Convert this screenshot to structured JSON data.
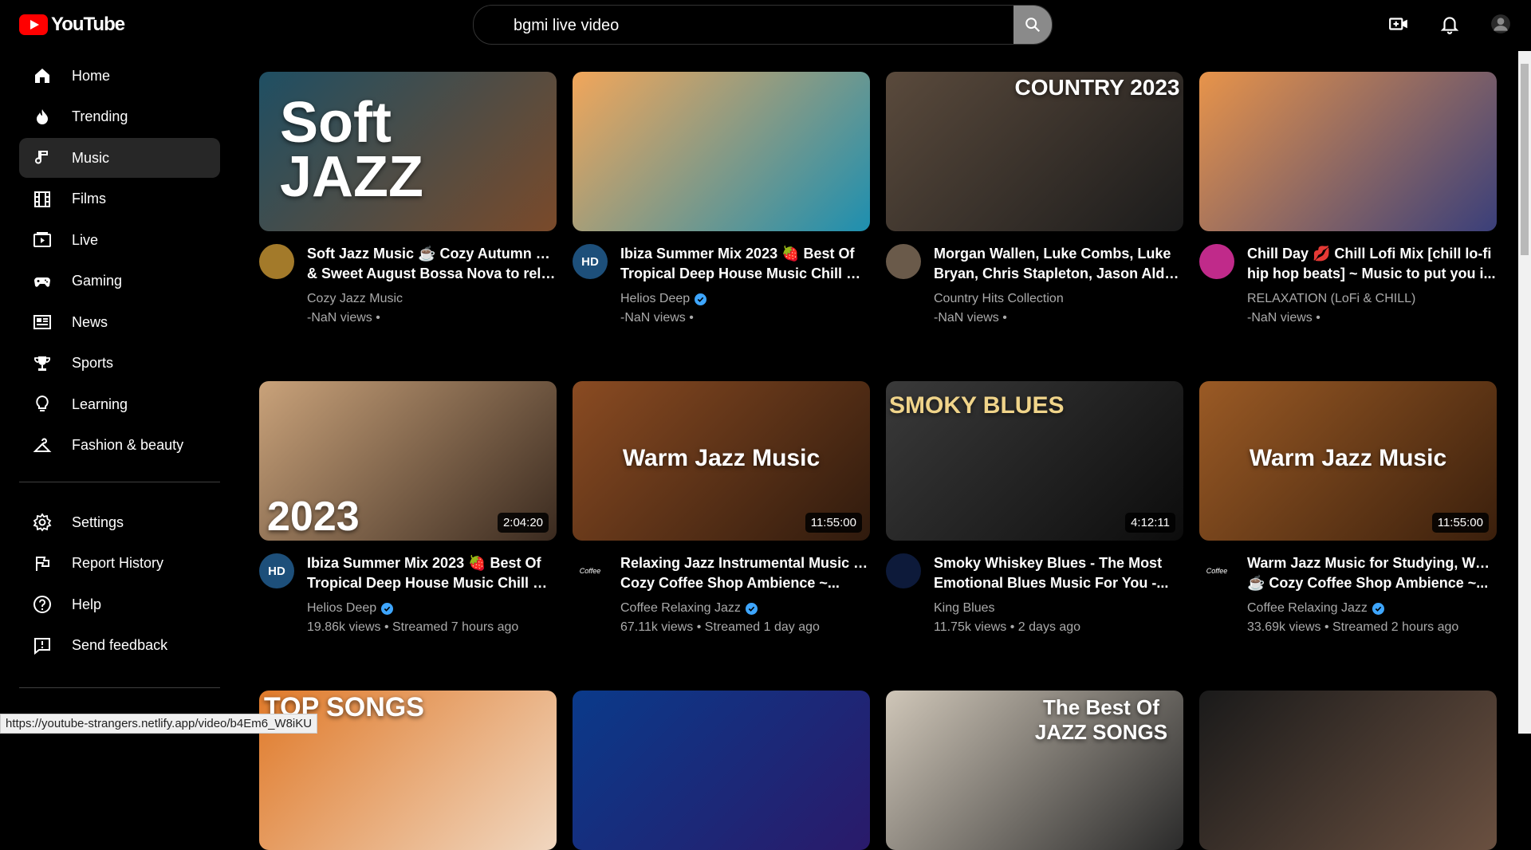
{
  "brand": {
    "name": "YouTube"
  },
  "search": {
    "value": "bgmi live video"
  },
  "sidebar": {
    "items": [
      {
        "label": "Home",
        "icon": "home-icon"
      },
      {
        "label": "Trending",
        "icon": "flame-icon"
      },
      {
        "label": "Music",
        "icon": "music-note-icon",
        "active": true
      },
      {
        "label": "Films",
        "icon": "film-icon"
      },
      {
        "label": "Live",
        "icon": "live-icon"
      },
      {
        "label": "Gaming",
        "icon": "gamepad-icon"
      },
      {
        "label": "News",
        "icon": "news-icon"
      },
      {
        "label": "Sports",
        "icon": "trophy-icon"
      },
      {
        "label": "Learning",
        "icon": "lightbulb-icon"
      },
      {
        "label": "Fashion & beauty",
        "icon": "hanger-icon"
      }
    ],
    "footer_items": [
      {
        "label": "Settings",
        "icon": "gear-icon"
      },
      {
        "label": "Report History",
        "icon": "flag-icon"
      },
      {
        "label": "Help",
        "icon": "help-icon"
      },
      {
        "label": "Send feedback",
        "icon": "feedback-icon"
      }
    ]
  },
  "videos": [
    {
      "thumb_text": "Soft JAZZ",
      "title1": "Soft Jazz Music ☕ Cozy Autumn Jazz",
      "title2": "& Sweet August Bossa Nova to rela...",
      "channel": "Cozy Jazz Music",
      "verified": false,
      "meta": "-NaN views •",
      "duration": "",
      "colors": [
        "#1f4f63",
        "#7a4a2a"
      ]
    },
    {
      "thumb_text": "",
      "title1": "Ibiza Summer Mix 2023 🍓 Best Of",
      "title2": "Tropical Deep House Music Chill Ou...",
      "channel": "Helios Deep",
      "verified": true,
      "meta": "-NaN views •",
      "duration": "",
      "colors": [
        "#f2a65a",
        "#1d8fb0"
      ]
    },
    {
      "thumb_text": "COUNTRY 2023",
      "title1": "Morgan Wallen, Luke Combs, Luke",
      "title2": "Bryan, Chris Stapleton, Jason Aldea...",
      "channel": "Country Hits Collection",
      "verified": false,
      "meta": "-NaN views •",
      "duration": "",
      "colors": [
        "#5a4a3c",
        "#1b1b1b"
      ]
    },
    {
      "thumb_text": "",
      "title1": "Chill Day 💋 Chill Lofi Mix [chill lo-fi",
      "title2": "hip hop beats] ~ Music to put you i...",
      "channel": "RELAXATION (LoFi & CHILL)",
      "verified": false,
      "meta": "-NaN views •",
      "duration": "",
      "colors": [
        "#e8944a",
        "#3a3f7a"
      ]
    },
    {
      "thumb_text": "2023",
      "title1": "Ibiza Summer Mix 2023 🍓 Best Of",
      "title2": "Tropical Deep House Music Chill Ou...",
      "channel": "Helios Deep",
      "verified": true,
      "meta": "19.86k views • Streamed 7 hours ago",
      "duration": "2:04:20",
      "colors": [
        "#c9a27a",
        "#3a2a1f"
      ]
    },
    {
      "thumb_text": "Warm Jazz Music",
      "title1": "Relaxing Jazz Instrumental Music ☕",
      "title2": "Cozy Coffee Shop Ambience ~...",
      "channel": "Coffee Relaxing Jazz",
      "verified": true,
      "meta": "67.11k views • Streamed 1 day ago",
      "duration": "11:55:00",
      "colors": [
        "#8a4b22",
        "#2f1a0d"
      ]
    },
    {
      "thumb_text": "SMOKY BLUES",
      "title1": "Smoky Whiskey Blues - The Most",
      "title2": "Emotional Blues Music For You -...",
      "channel": "King Blues",
      "verified": false,
      "meta": "11.75k views • 2 days ago",
      "duration": "4:12:11",
      "colors": [
        "#3a3a3a",
        "#0c0c0c"
      ]
    },
    {
      "thumb_text": "Warm Jazz Music",
      "title1": "Warm Jazz Music for Studying, Work",
      "title2": "☕ Cozy Coffee Shop Ambience ~...",
      "channel": "Coffee Relaxing Jazz",
      "verified": true,
      "meta": "33.69k views • Streamed 2 hours ago",
      "duration": "11:55:00",
      "colors": [
        "#9a5a25",
        "#3a1f0c"
      ]
    },
    {
      "thumb_text": "TOP SONGS",
      "title1": "",
      "title2": "",
      "channel": "",
      "verified": false,
      "meta": "",
      "duration": "",
      "colors": [
        "#e07a2a",
        "#f0d7c0"
      ]
    },
    {
      "thumb_text": "",
      "title1": "",
      "title2": "",
      "channel": "",
      "verified": false,
      "meta": "",
      "duration": "",
      "colors": [
        "#0a3a8a",
        "#2a1a6a"
      ]
    },
    {
      "thumb_text": "The Best Of JAZZ SONGS",
      "title1": "",
      "title2": "",
      "channel": "",
      "verified": false,
      "meta": "",
      "duration": "",
      "colors": [
        "#cfc6b8",
        "#2a2a2a"
      ]
    },
    {
      "thumb_text": "",
      "title1": "",
      "title2": "",
      "channel": "",
      "verified": false,
      "meta": "",
      "duration": "",
      "colors": [
        "#1a1a1a",
        "#6a5040"
      ]
    }
  ],
  "avatars": [
    {
      "text": "",
      "bg": "#a37a2a"
    },
    {
      "text": "HD",
      "bg": "#1d4f7a"
    },
    {
      "text": "",
      "bg": "#6a5a4a"
    },
    {
      "text": "",
      "bg": "#c02a8a"
    },
    {
      "text": "HD",
      "bg": "#1d4f7a"
    },
    {
      "text": "Coffee",
      "bg": "#000000"
    },
    {
      "text": "",
      "bg": "#0d1a3a"
    },
    {
      "text": "Coffee",
      "bg": "#000000"
    }
  ],
  "status_url": "https://youtube-strangers.netlify.app/video/b4Em6_W8iKU",
  "colors": {
    "accent": "#ff0000",
    "verified": "#3ea6ff",
    "active_bg": "#272727"
  }
}
